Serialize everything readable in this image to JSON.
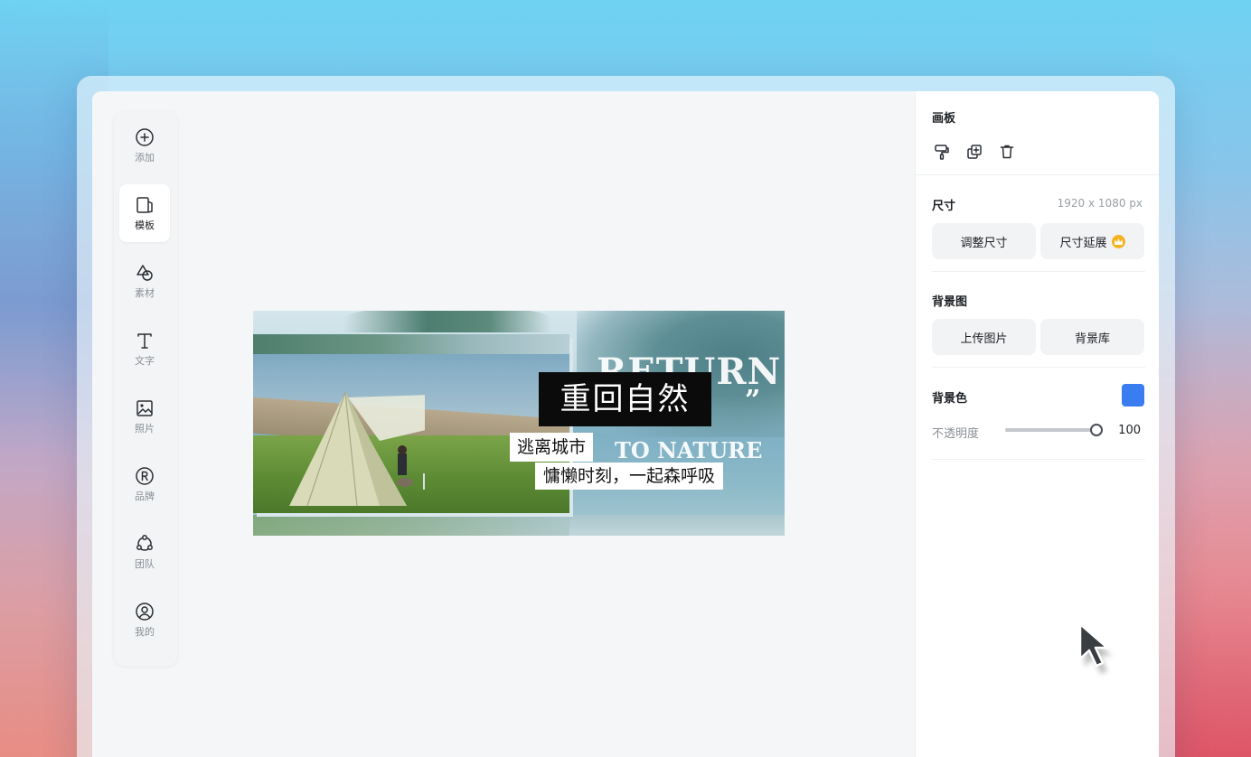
{
  "toolbar": {
    "items": [
      {
        "label": "添加",
        "icon": "add-circle-icon"
      },
      {
        "label": "模板",
        "icon": "template-icon",
        "active": true
      },
      {
        "label": "素材",
        "icon": "shapes-icon"
      },
      {
        "label": "文字",
        "icon": "text-icon"
      },
      {
        "label": "照片",
        "icon": "image-icon"
      },
      {
        "label": "品牌",
        "icon": "registered-icon"
      },
      {
        "label": "团队",
        "icon": "team-icon"
      },
      {
        "label": "我的",
        "icon": "user-icon"
      }
    ]
  },
  "canvas": {
    "title": "重回自然",
    "return_text": "RETURN",
    "quote": "”",
    "to_nature": "TO NATURE",
    "subtitle_1": "逃离城市",
    "subtitle_2": "慵懒时刻，一起森呼吸"
  },
  "panel": {
    "title": "画板",
    "size": {
      "label": "尺寸",
      "value": "1920 x 1080 px",
      "resize_button": "调整尺寸",
      "extend_button": "尺寸延展"
    },
    "background_image": {
      "label": "背景图",
      "upload_button": "上传图片",
      "library_button": "背景库"
    },
    "background_color": {
      "label": "背景色",
      "color": "#3a7df0"
    },
    "opacity": {
      "label": "不透明度",
      "value": "100",
      "level": 1.0
    }
  },
  "colors": {
    "accent": "#3a7df0",
    "premium": "#f5b324"
  }
}
